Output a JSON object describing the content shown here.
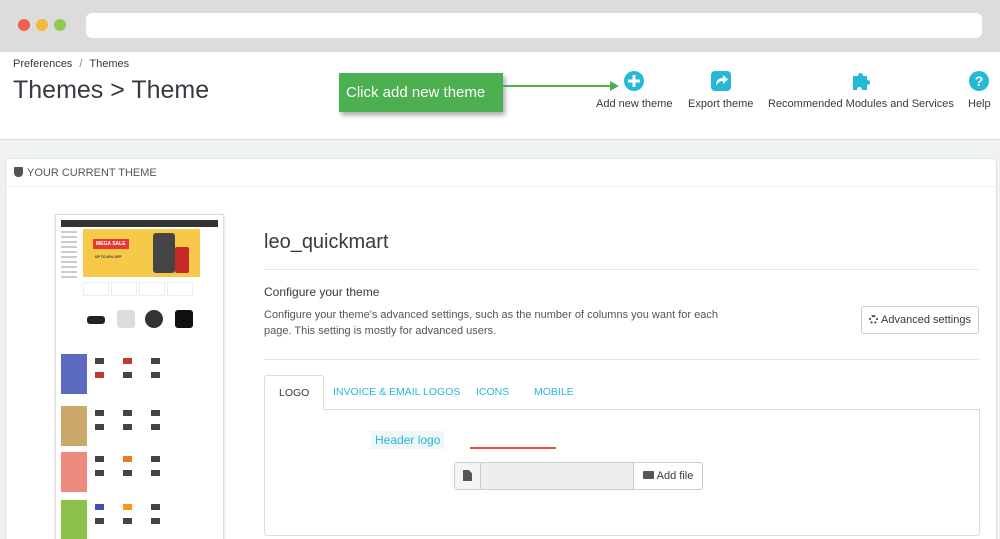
{
  "breadcrumb": {
    "parent": "Preferences",
    "separator": "/",
    "current": "Themes"
  },
  "page_title": "Themes > Theme",
  "callout": {
    "text": "Click add new theme",
    "color": "#4caf50"
  },
  "toolbar": {
    "add_new_theme": {
      "label": "Add new theme",
      "icon": "plus-circle-icon"
    },
    "export_theme": {
      "label": "Export theme",
      "icon": "share-icon"
    },
    "recommended": {
      "label": "Recommended Modules and Services",
      "icon": "puzzle-icon"
    },
    "help": {
      "label": "Help",
      "icon": "question-icon"
    },
    "icon_color": "#25b9d7"
  },
  "panel": {
    "heading": "YOUR CURRENT THEME",
    "theme_name": "leo_quickmart",
    "configure_title": "Configure your theme",
    "configure_desc": "Configure your theme's advanced settings, such as the number of columns you want for each page. This setting is mostly for advanced users.",
    "advanced_settings_label": "Advanced settings",
    "tabs": [
      "LOGO",
      "INVOICE & EMAIL LOGOS",
      "ICONS",
      "MOBILE"
    ],
    "active_tab": "LOGO",
    "header_logo_label": "Header logo",
    "add_file_label": "Add file"
  },
  "thumbnail": {
    "banner_text": "MEGA SALE",
    "banner_sub": "UP TO 40% OFF"
  }
}
